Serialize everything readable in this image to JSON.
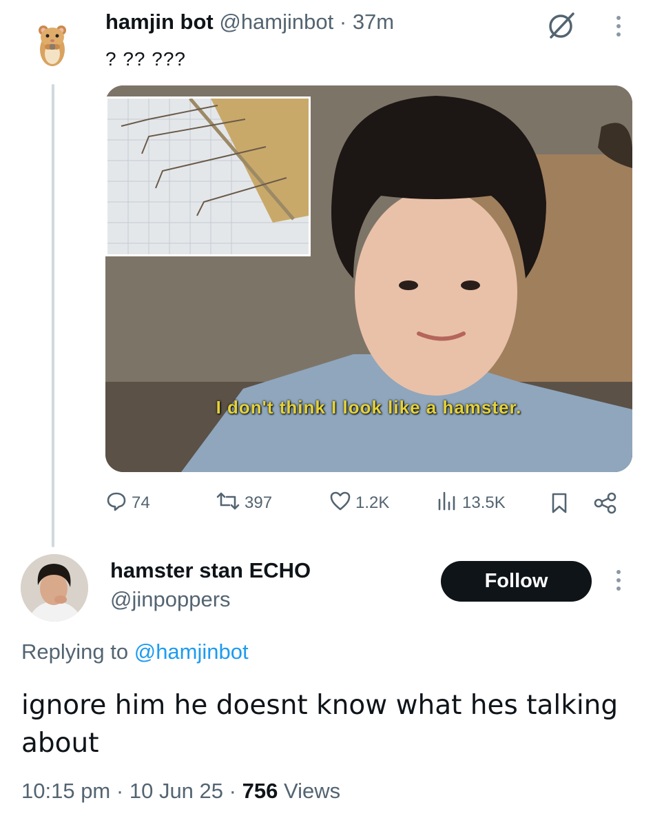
{
  "parent_tweet": {
    "display_name": "hamjin bot",
    "handle": "@hamjinbot",
    "separator": "·",
    "time": "37m",
    "text": "? ?? ???",
    "media": {
      "caption": "I don't think I look like a hamster."
    },
    "stats": {
      "replies": "74",
      "reposts": "397",
      "likes": "1.2K",
      "views": "13.5K"
    }
  },
  "reply_tweet": {
    "display_name": "hamster stan ECHO",
    "handle": "@jinpoppers",
    "follow_label": "Follow",
    "replying_prefix": "Replying to",
    "replying_handle": "@hamjinbot",
    "text": "ignore him he doesnt know what hes talking about",
    "footer": {
      "time": "10:15 pm",
      "separator": "·",
      "date": "10 Jun 25",
      "views_count": "756",
      "views_label": "Views"
    }
  },
  "colors": {
    "text_primary": "#0f1419",
    "text_secondary": "#536471",
    "link": "#1d9bf0",
    "follow_button_bg": "#0f1419",
    "caption_yellow": "#e4d23a"
  },
  "icons": [
    "hamster-avatar",
    "grok-icon",
    "more-icon",
    "reply-icon",
    "repost-icon",
    "like-icon",
    "views-icon",
    "bookmark-icon",
    "share-icon"
  ]
}
